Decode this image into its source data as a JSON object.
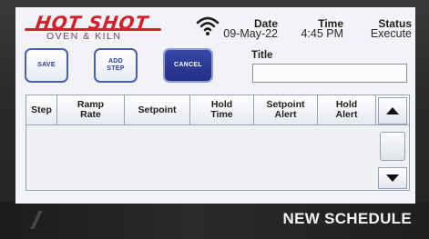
{
  "brand": {
    "logo_text": "HOT SHOT",
    "subtitle": "OVEN & KILN"
  },
  "status_bar": {
    "wifi_icon": "wifi-icon",
    "date_label": "Date",
    "date_value": "09-May-22",
    "time_label": "Time",
    "time_value": "4:45 PM",
    "status_label": "Status",
    "status_value": "Execute"
  },
  "toolbar": {
    "save_label": "SAVE",
    "add_step_label": "ADD STEP",
    "cancel_label": "CANCEL"
  },
  "title_field": {
    "label": "Title",
    "value": ""
  },
  "table": {
    "columns": [
      "Step",
      "Ramp Rate",
      "Setpoint",
      "Hold Time",
      "Setpoint Alert",
      "Hold Alert"
    ],
    "rows": []
  },
  "scroll": {
    "up_icon": "triangle-up-icon",
    "down_icon": "triangle-down-icon"
  },
  "screen_title": "NEW SCHEDULE",
  "colors": {
    "brand_red": "#d4202a",
    "accent_blue": "#2f3f8f",
    "primary_button": "#2a3690"
  }
}
